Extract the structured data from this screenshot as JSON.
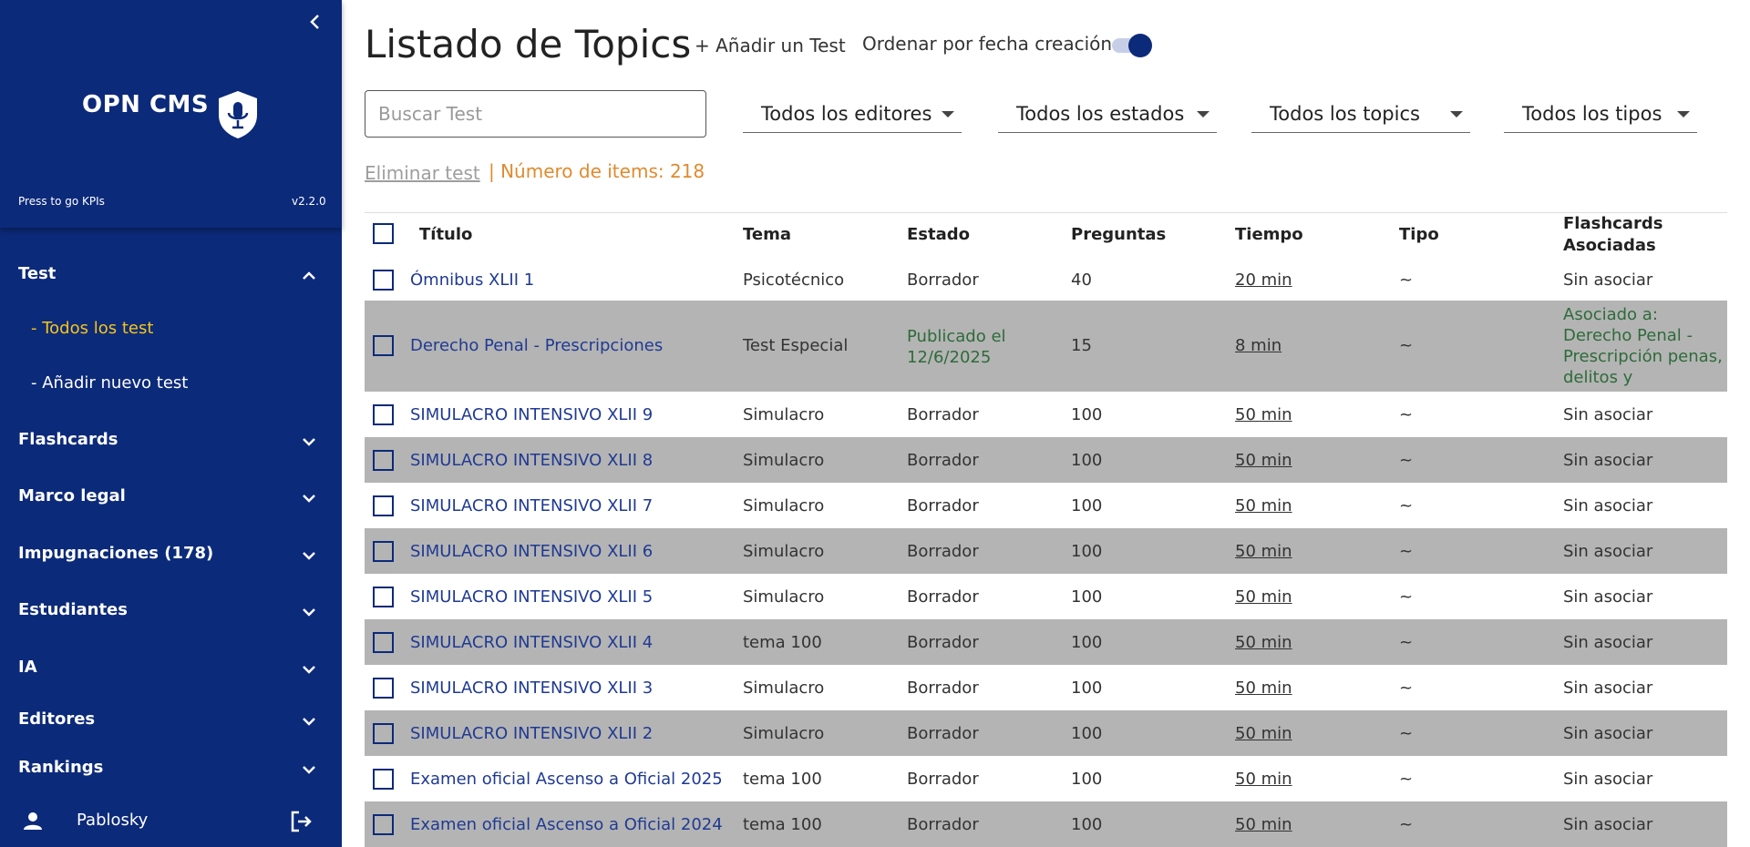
{
  "sidebar": {
    "brand": "OPN CMS",
    "kpi_link": "Press to go KPIs",
    "version": "v2.2.0",
    "sections": [
      {
        "label": "Test",
        "expanded": true,
        "subitems": [
          {
            "label": "- Todos los test",
            "active": true
          },
          {
            "label": "- Añadir nuevo test",
            "active": false
          }
        ]
      },
      {
        "label": "Flashcards",
        "expanded": false
      },
      {
        "label": "Marco legal",
        "expanded": false
      },
      {
        "label": "Impugnaciones (178)",
        "expanded": false
      },
      {
        "label": "Estudiantes",
        "expanded": false
      },
      {
        "label": "IA",
        "expanded": false
      },
      {
        "label": "Editores",
        "expanded": false
      },
      {
        "label": "Rankings",
        "expanded": false
      }
    ],
    "user": {
      "name": "Pablosky"
    },
    "icons": {
      "collapse": "chevron-left-icon",
      "logo": "shield-microphone-icon",
      "user": "person-icon",
      "logout": "logout-icon"
    }
  },
  "main": {
    "title": "Listado de Topics",
    "add_test_label": "+ Añadir un Test",
    "order_label": "Ordenar por fecha creación",
    "order_toggle_on": true,
    "search_placeholder": "Buscar Test",
    "filters": [
      "Todos los editores",
      "Todos los estados",
      "Todos los topics",
      "Todos los tipos"
    ],
    "delete_label": "Eliminar test",
    "item_count": "| Número de items: 218"
  },
  "colors": {
    "sidebar_bg": "#0c2a7a",
    "active_nav": "#f5c518",
    "count_orange": "#e08a2e",
    "link_blue": "#1f3a93",
    "published_green": "#2e6b3a",
    "row_gray": "#b4b4b4"
  },
  "table": {
    "headers": [
      "Título",
      "Tema",
      "Estado",
      "Preguntas",
      "Tiempo",
      "Tipo",
      "Flashcards Asociadas"
    ],
    "rows": [
      {
        "titulo": "Ómnibus XLII 1",
        "tema": "Psicotécnico",
        "estado": "Borrador",
        "preguntas": "40",
        "tiempo": "20 min",
        "tipo": "~",
        "flashcards": "Sin asociar"
      },
      {
        "titulo": "Derecho Penal - Prescripciones",
        "tema": "Test Especial",
        "estado": "Publicado el 12/6/2025",
        "preguntas": "15",
        "tiempo": "8 min",
        "tipo": "~",
        "flashcards": "Asociado a: Derecho Penal - Prescripción penas, delitos y Cancelación Antece..."
      },
      {
        "titulo": "SIMULACRO INTENSIVO XLII 9",
        "tema": "Simulacro",
        "estado": "Borrador",
        "preguntas": "100",
        "tiempo": "50 min",
        "tipo": "~",
        "flashcards": "Sin asociar"
      },
      {
        "titulo": "SIMULACRO INTENSIVO XLII 8",
        "tema": "Simulacro",
        "estado": "Borrador",
        "preguntas": "100",
        "tiempo": "50 min",
        "tipo": "~",
        "flashcards": "Sin asociar"
      },
      {
        "titulo": "SIMULACRO INTENSIVO XLII 7",
        "tema": "Simulacro",
        "estado": "Borrador",
        "preguntas": "100",
        "tiempo": "50 min",
        "tipo": "~",
        "flashcards": "Sin asociar"
      },
      {
        "titulo": "SIMULACRO INTENSIVO XLII 6",
        "tema": "Simulacro",
        "estado": "Borrador",
        "preguntas": "100",
        "tiempo": "50 min",
        "tipo": "~",
        "flashcards": "Sin asociar"
      },
      {
        "titulo": "SIMULACRO INTENSIVO XLII 5",
        "tema": "Simulacro",
        "estado": "Borrador",
        "preguntas": "100",
        "tiempo": "50 min",
        "tipo": "~",
        "flashcards": "Sin asociar"
      },
      {
        "titulo": "SIMULACRO INTENSIVO XLII 4",
        "tema": "tema 100",
        "estado": "Borrador",
        "preguntas": "100",
        "tiempo": "50 min",
        "tipo": "~",
        "flashcards": "Sin asociar"
      },
      {
        "titulo": "SIMULACRO INTENSIVO XLII 3",
        "tema": "Simulacro",
        "estado": "Borrador",
        "preguntas": "100",
        "tiempo": "50 min",
        "tipo": "~",
        "flashcards": "Sin asociar"
      },
      {
        "titulo": "SIMULACRO INTENSIVO XLII 2",
        "tema": "Simulacro",
        "estado": "Borrador",
        "preguntas": "100",
        "tiempo": "50 min",
        "tipo": "~",
        "flashcards": "Sin asociar"
      },
      {
        "titulo": "Examen oficial Ascenso a Oficial 2025",
        "tema": "tema 100",
        "estado": "Borrador",
        "preguntas": "100",
        "tiempo": "50 min",
        "tipo": "~",
        "flashcards": "Sin asociar"
      },
      {
        "titulo": "Examen oficial Ascenso a Oficial 2024",
        "tema": "tema 100",
        "estado": "Borrador",
        "preguntas": "100",
        "tiempo": "50 min",
        "tipo": "~",
        "flashcards": "Sin asociar"
      }
    ]
  }
}
